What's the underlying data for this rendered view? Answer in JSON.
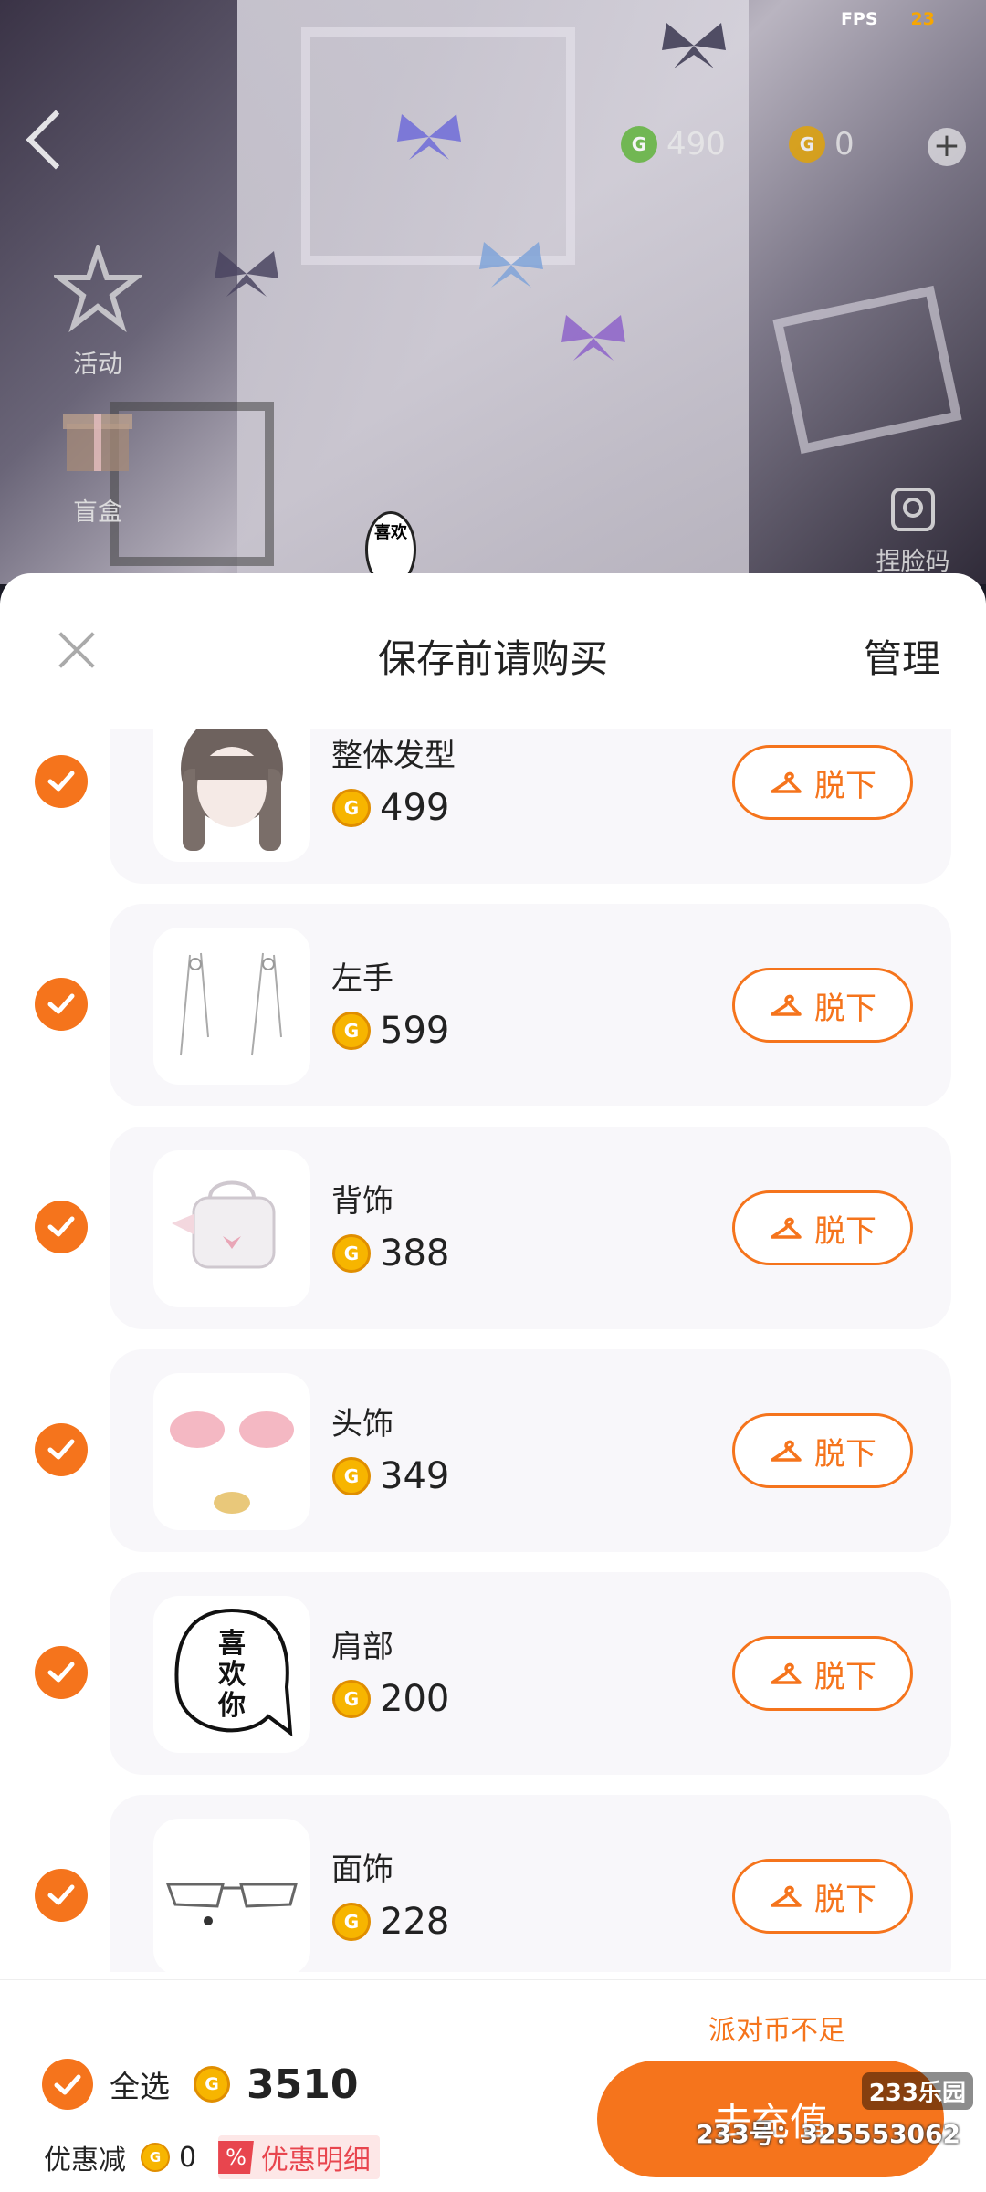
{
  "status": {
    "fps_label": "FPS",
    "fps_value": "23"
  },
  "top_bar": {
    "green_currency_value": "490",
    "gold_currency_value": "0"
  },
  "side_menu": {
    "activities_label": "活动",
    "blind_box_label": "盲盒",
    "face_code_label": "捏脸码"
  },
  "scene": {
    "speech_bubble_text": "喜欢"
  },
  "sheet": {
    "title": "保存前请购买",
    "manage_label": "管理"
  },
  "items": [
    {
      "name": "整体发型",
      "price": "499",
      "action_label": "脱下"
    },
    {
      "name": "左手",
      "price": "599",
      "action_label": "脱下"
    },
    {
      "name": "背饰",
      "price": "388",
      "action_label": "脱下"
    },
    {
      "name": "头饰",
      "price": "349",
      "action_label": "脱下"
    },
    {
      "name": "肩部",
      "price": "200",
      "action_label": "脱下"
    },
    {
      "name": "面饰",
      "price": "228",
      "action_label": "脱下"
    }
  ],
  "shoulder_item_text": "喜欢你",
  "footer": {
    "insufficient_label": "派对币不足",
    "select_all_label": "全选",
    "total_price": "3510",
    "discount_label": "优惠减",
    "discount_value": "0",
    "discount_detail_badge": "%",
    "discount_detail_label": "优惠明细",
    "recharge_label": "去充值"
  },
  "watermark": {
    "logo": "233乐园",
    "id_text": "233号：325553062"
  },
  "colors": {
    "accent": "#f5741c",
    "coin_gold": "#f7b500",
    "card_bg": "#f8f7fa",
    "detail_red": "#e8454e"
  }
}
